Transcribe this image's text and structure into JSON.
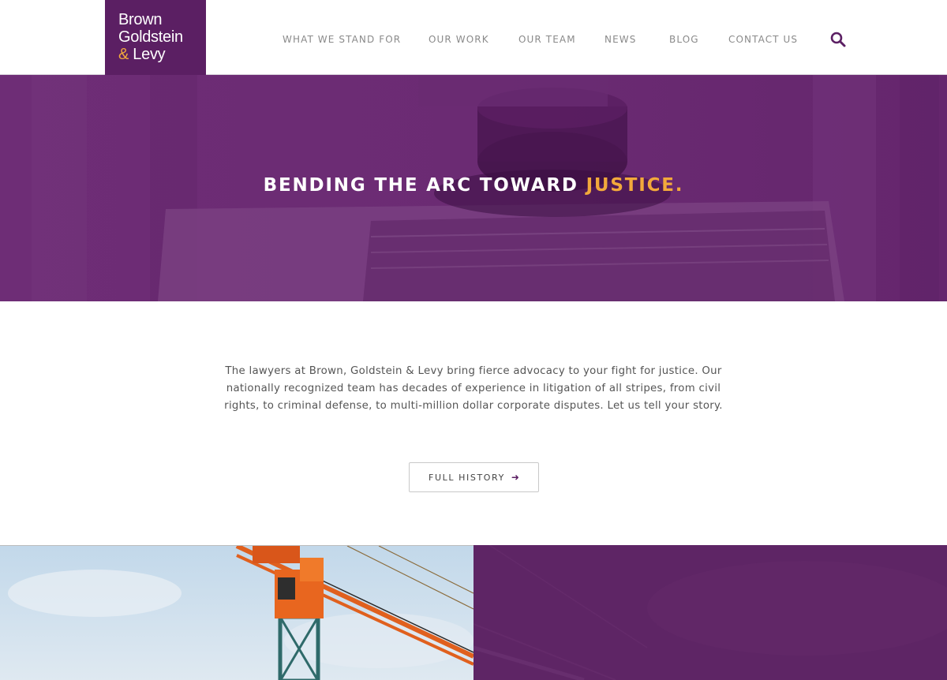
{
  "logo": {
    "line1": "Brown",
    "line2": "Goldstein",
    "line3_amp": "&",
    "line3_rest": " Levy"
  },
  "nav": {
    "items": [
      {
        "label": "WHAT WE STAND FOR"
      },
      {
        "label": "OUR WORK"
      },
      {
        "label": "OUR TEAM"
      },
      {
        "label": "NEWS"
      },
      {
        "label": "BLOG"
      },
      {
        "label": "CONTACT US"
      }
    ],
    "search_icon": "search-icon"
  },
  "hero": {
    "title_main": "BENDING THE ARC TOWARD ",
    "title_accent": "JUSTICE."
  },
  "intro": {
    "text": "The lawyers at Brown, Goldstein & Levy bring fierce advocacy to your fight for justice. Our nationally recognized team has decades of experience in litigation of all stripes, from civil rights, to criminal defense, to multi-million dollar corporate disputes. Let us tell your story.",
    "button_label": "FULL HISTORY",
    "button_icon": "arrow-right-icon"
  },
  "colors": {
    "brand_purple": "#5b1f63",
    "accent_gold": "#f2a93b",
    "nav_text": "#8a8a8a"
  }
}
